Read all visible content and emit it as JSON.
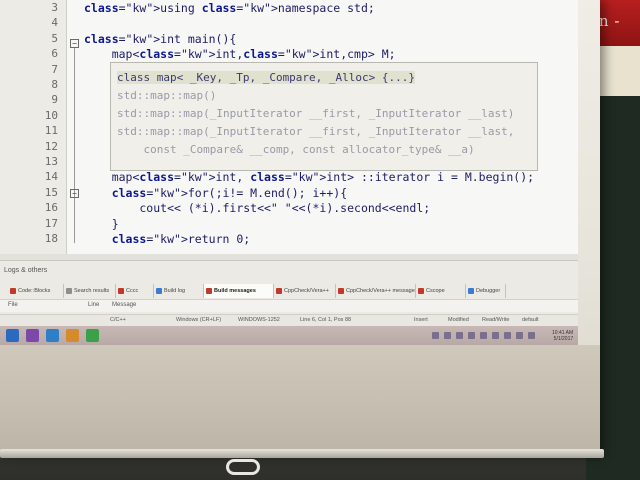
{
  "room": {
    "banner_text": "Nin -"
  },
  "editor": {
    "line_numbers": [
      "3",
      "4",
      "5",
      "6",
      "7",
      "8",
      "9",
      "10",
      "11",
      "12",
      "13",
      "14",
      "15",
      "16",
      "17",
      "18"
    ],
    "lines": [
      {
        "text": "using namespace std;"
      },
      {
        "text": ""
      },
      {
        "text": "int main(){"
      },
      {
        "text": "    map<int,int,cmp> M;"
      },
      {
        "text": ""
      },
      {
        "text": ""
      },
      {
        "text": ""
      },
      {
        "text": ""
      },
      {
        "text": ""
      },
      {
        "text": "    }"
      },
      {
        "text": ""
      },
      {
        "text": "    map<int, int> ::iterator i = M.begin();"
      },
      {
        "text": "    for(;i!= M.end(); i++){"
      },
      {
        "text": "        cout<< (*i).first<<\" \"<<(*i).second<<endl;"
      },
      {
        "text": "    }"
      },
      {
        "text": "    return 0;"
      }
    ],
    "tooltip": [
      "class map< _Key, _Tp, _Compare, _Alloc> {...}",
      "std::map::map()",
      "std::map::map(_InputIterator __first, _InputIterator __last)",
      "std::map::map(_InputIterator __first, _InputIterator __last,",
      "    const _Compare& __comp, const allocator_type& __a)"
    ]
  },
  "logs": {
    "title": "Logs & others",
    "tabs": [
      {
        "label": "Code::Blocks",
        "color": "#c0392b"
      },
      {
        "label": "Search results",
        "color": "#8e8e8e"
      },
      {
        "label": "Cccc",
        "color": "#c0392b"
      },
      {
        "label": "Build log",
        "color": "#3a7bd5"
      },
      {
        "label": "Build messages",
        "color": "#c0392b",
        "active": true
      },
      {
        "label": "CppCheck/Vera++",
        "color": "#c0392b"
      },
      {
        "label": "CppCheck/Vera++ messages",
        "color": "#c0392b"
      },
      {
        "label": "Cscope",
        "color": "#c0392b"
      },
      {
        "label": "Debugger",
        "color": "#3a7bd5"
      }
    ],
    "columns": {
      "file": "File",
      "line": "Line",
      "message": "Message"
    }
  },
  "status_bar": {
    "language": "C/C++",
    "eol": "Windows (CR+LF)",
    "encoding": "WINDOWS-1252",
    "position": "Line 6, Col 1, Pos 88",
    "mode": "Insert",
    "modified": "Modified",
    "access": "Read/Write",
    "profile": "default"
  },
  "taskbar": {
    "buttons": [
      {
        "name": "start",
        "color": "#2b6bbf"
      },
      {
        "name": "app-1",
        "color": "#7b4aa8"
      },
      {
        "name": "app-2",
        "color": "#2f7fc7"
      },
      {
        "name": "app-3",
        "color": "#d78a2b"
      },
      {
        "name": "app-4",
        "color": "#3aa04a"
      }
    ],
    "clock_time": "10:41 AM",
    "clock_date": "5/1/2017"
  }
}
